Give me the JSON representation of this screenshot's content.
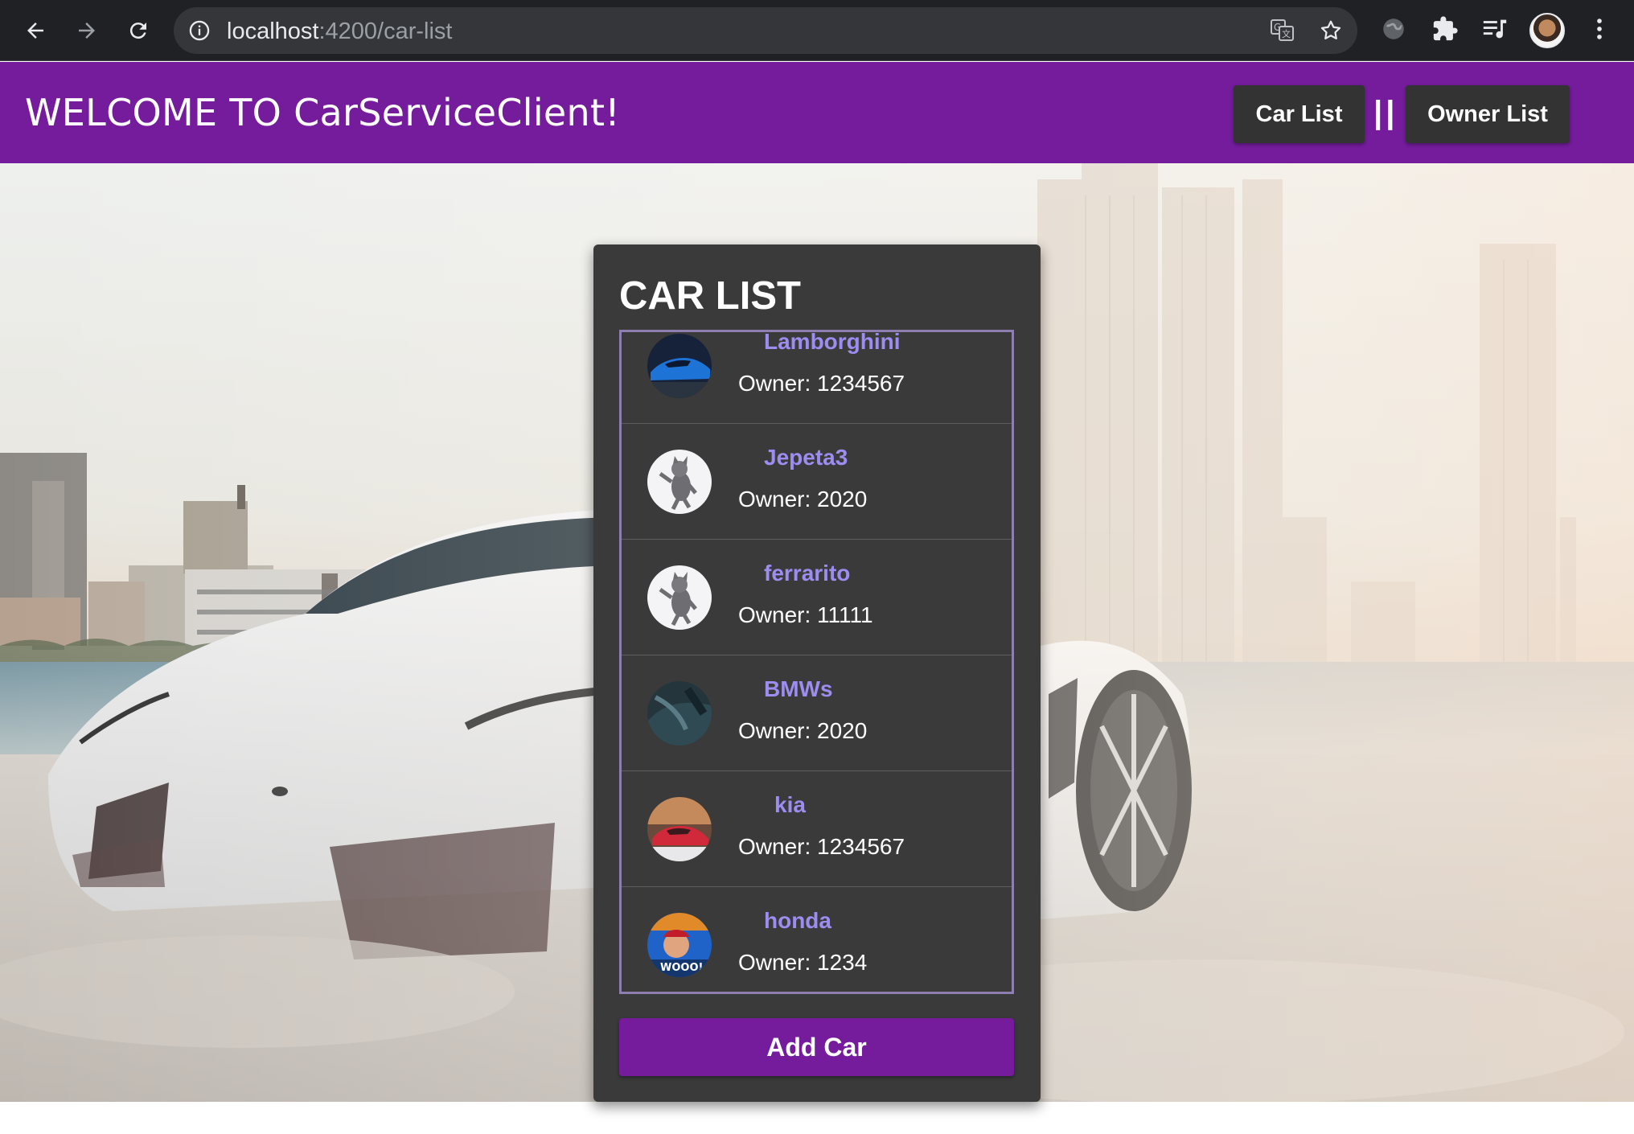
{
  "browser": {
    "url_host": "localhost",
    "url_path": ":4200/car-list"
  },
  "header": {
    "title": "WELCOME TO CarServiceClient!",
    "car_list_label": "Car List",
    "separator": "||",
    "owner_list_label": "Owner List",
    "brand_color": "#741c9c"
  },
  "card": {
    "title": "CAR LIST",
    "cars": [
      {
        "name": "Lamborghini",
        "owner": "Owner: 1234567",
        "thumb": "blue-sports-car"
      },
      {
        "name": "Jepeta3",
        "owner": "Owner: 2020",
        "thumb": "dancing-cat"
      },
      {
        "name": "ferrarito",
        "owner": "Owner: 11111",
        "thumb": "dancing-cat"
      },
      {
        "name": "BMWs",
        "owner": "Owner: 2020",
        "thumb": "dark-car"
      },
      {
        "name": "kia",
        "owner": "Owner: 1234567",
        "thumb": "red-car"
      },
      {
        "name": "honda",
        "owner": "Owner: 1234",
        "thumb": "wooo-meme"
      }
    ],
    "add_button_label": "Add Car"
  }
}
